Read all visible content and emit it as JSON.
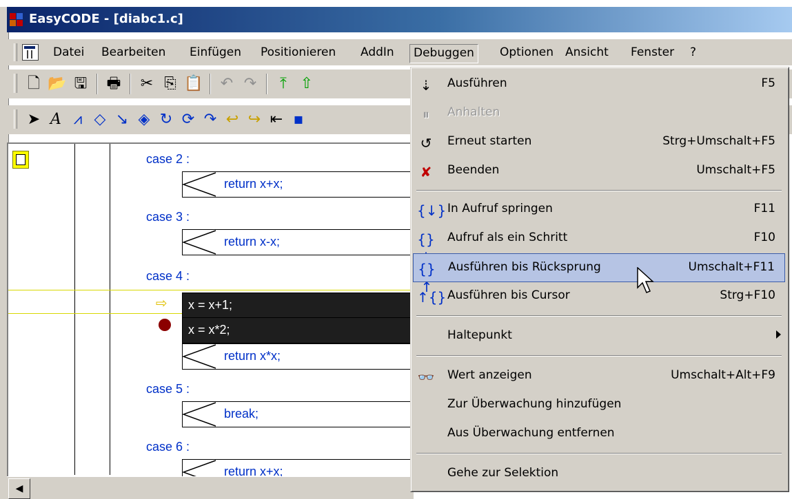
{
  "window": {
    "title": "EasyCODE - [diabc1.c]"
  },
  "menubar": {
    "items": [
      "Datei",
      "Bearbeiten",
      "Einfügen",
      "Positionieren",
      "AddIn",
      "Debuggen",
      "Optionen",
      "Ansicht",
      "Fenster",
      "?"
    ],
    "active": "Debuggen"
  },
  "toolbar1": {
    "icons": [
      "new-file-icon",
      "open-folder-icon",
      "save-icon",
      "print-icon",
      "cut-icon",
      "copy-icon",
      "paste-icon",
      "undo-icon",
      "redo-icon",
      "move-top-icon",
      "move-up-icon"
    ]
  },
  "toolbar2": {
    "icons": [
      "select-arrow-icon",
      "text-icon",
      "comment-icon",
      "branch-icon",
      "loop-icon",
      "diamond-icon",
      "step-into-icon",
      "step-over-icon",
      "step-out-icon",
      "return-icon",
      "break-icon",
      "exit-icon",
      "module-icon"
    ]
  },
  "editor": {
    "cases": [
      "case 2 :",
      "case 3 :",
      "case 4 :",
      "case 5 :",
      "case 6 :"
    ],
    "statements": [
      "return x+x;",
      "return x-x;",
      "x = x+1;",
      "x = x*2;",
      "return x*x;",
      "break;",
      "return x+x;"
    ],
    "exec_marker": "⇨",
    "colors": {
      "code": "#0030c8",
      "highlight_bg": "#1e1e1e",
      "breakpoint": "#8b0000",
      "exec_line": "#d8d800"
    }
  },
  "debug_menu": {
    "items": [
      {
        "label": "Ausführen",
        "shortcut": "F5",
        "icon": "run-icon",
        "disabled": false
      },
      {
        "label": "Anhalten",
        "shortcut": "",
        "icon": "pause-icon",
        "disabled": true
      },
      {
        "label": "Erneut starten",
        "shortcut": "Strg+Umschalt+F5",
        "icon": "restart-icon",
        "disabled": false
      },
      {
        "label": "Beenden",
        "shortcut": "Umschalt+F5",
        "icon": "stop-icon",
        "disabled": false
      },
      {
        "label": "In Aufruf springen",
        "shortcut": "F11",
        "icon": "step-into-icon",
        "disabled": false
      },
      {
        "label": "Aufruf als ein Schritt",
        "shortcut": "F10",
        "icon": "step-over-icon",
        "disabled": false
      },
      {
        "label": "Ausführen bis Rücksprung",
        "shortcut": "Umschalt+F11",
        "icon": "step-out-icon",
        "disabled": false,
        "highlighted": true
      },
      {
        "label": "Ausführen bis Cursor",
        "shortcut": "Strg+F10",
        "icon": "run-to-cursor-icon",
        "disabled": false
      },
      {
        "label": "Haltepunkt",
        "shortcut": "",
        "icon": "",
        "submenu": true
      },
      {
        "label": "Wert anzeigen",
        "shortcut": "Umschalt+Alt+F9",
        "icon": "glasses-icon",
        "disabled": false
      },
      {
        "label": "Zur Überwachung hinzufügen",
        "shortcut": "",
        "icon": "",
        "disabled": false
      },
      {
        "label": "Aus Überwachung entfernen",
        "shortcut": "",
        "icon": "",
        "disabled": false
      },
      {
        "label": "Gehe zur Selektion",
        "shortcut": "",
        "icon": "",
        "disabled": false
      }
    ],
    "highlight_color": "#b6c4e4"
  }
}
